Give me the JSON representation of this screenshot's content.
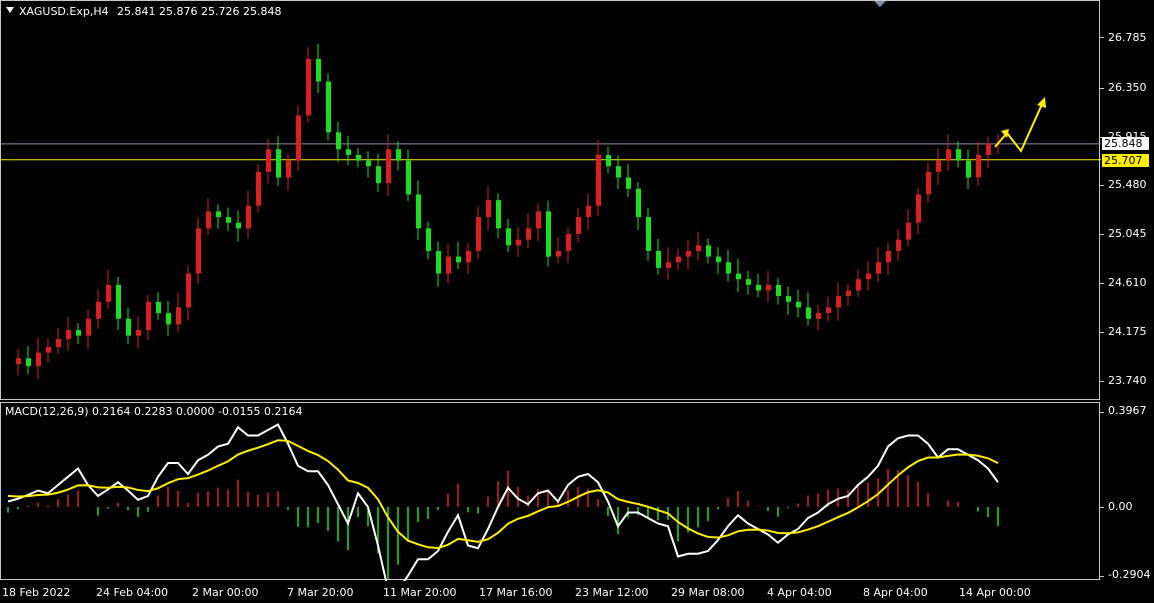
{
  "chart": {
    "symbol": "XAGUSD.Exp,H4",
    "ohlc": "25.841 25.876 25.726 25.848",
    "colors": {
      "bull": "#dd1e1e",
      "bear": "#19e01e",
      "macd": "#ffffff",
      "signal": "#ffee00",
      "hline": "#8a8fa8",
      "level": "#ffee00",
      "arrow": "#ffee00"
    },
    "price_scale": [
      "26.785",
      "26.350",
      "25.915",
      "25.480",
      "25.045",
      "24.610",
      "24.175",
      "23.740"
    ],
    "current_price": "25.848",
    "level_price": "25.707",
    "time_axis": [
      "18 Feb 2022",
      "24 Feb 04:00",
      "2 Mar 00:00",
      "7 Mar 20:00",
      "11 Mar 20:00",
      "17 Mar 16:00",
      "23 Mar 12:00",
      "29 Mar 08:00",
      "4 Apr 04:00",
      "8 Apr 04:00",
      "14 Apr 00:00"
    ]
  },
  "macd": {
    "label": "MACD(12,26,9) 0.2164 0.2283 0.0000 -0.0155 0.2164",
    "scale": [
      "0.3967",
      "0.00",
      "-0.2904"
    ]
  },
  "chart_data": {
    "type": "line",
    "title": "XAGUSD.Exp,H4",
    "x": [
      0,
      10,
      20,
      30,
      40,
      50,
      60,
      70,
      80,
      90,
      100,
      110,
      120,
      130,
      140,
      150,
      160,
      170,
      180,
      190,
      200,
      210,
      220,
      230,
      240,
      250,
      260,
      270,
      280,
      290,
      300,
      310,
      320,
      330,
      340,
      350,
      360,
      370,
      380,
      390,
      400,
      410,
      420,
      430,
      440,
      450,
      460,
      470,
      480,
      490,
      500,
      510,
      520,
      530,
      540,
      550,
      560,
      570,
      580,
      590,
      600,
      610,
      620,
      630,
      640,
      650,
      660,
      670,
      680,
      690,
      700,
      710,
      720,
      730,
      740,
      750,
      760,
      770,
      780,
      790,
      800,
      810,
      820,
      830,
      840,
      850,
      860,
      870,
      880,
      890,
      900,
      910,
      920,
      930,
      940,
      950,
      960,
      970,
      980,
      990
    ],
    "series": [
      {
        "values": [
          23.9,
          23.95,
          23.88,
          24.0,
          24.05,
          24.12,
          24.2,
          24.15,
          24.3,
          24.45,
          24.6,
          24.3,
          24.15,
          24.2,
          24.45,
          24.35,
          24.25,
          24.4,
          24.7,
          25.1,
          25.25,
          25.2,
          25.15,
          25.1,
          25.3,
          25.6,
          25.8,
          25.55,
          25.7,
          26.1,
          26.6,
          26.4,
          25.95,
          25.8,
          25.75,
          25.7,
          25.65,
          25.5,
          25.8,
          25.7,
          25.4,
          25.1,
          24.9,
          24.7,
          24.85,
          24.8,
          24.9,
          25.2,
          25.35,
          25.1,
          24.95,
          25.0,
          25.1,
          25.25,
          24.85,
          24.9,
          25.05,
          25.2,
          25.3,
          25.75,
          25.65,
          25.55,
          25.45,
          25.2,
          24.9,
          24.75,
          24.8,
          24.85,
          24.9,
          24.95,
          24.85,
          24.8,
          24.7,
          24.65,
          24.6,
          24.55,
          24.6,
          24.5,
          24.45,
          24.4,
          24.3,
          24.35,
          24.4,
          24.5,
          24.55,
          24.65,
          24.7,
          24.8,
          24.9,
          25.0,
          25.15,
          25.4,
          25.6,
          25.7,
          25.8,
          25.7,
          25.55,
          25.75,
          25.85,
          25.85
        ]
      }
    ],
    "ylim": [
      23.74,
      26.785
    ]
  }
}
